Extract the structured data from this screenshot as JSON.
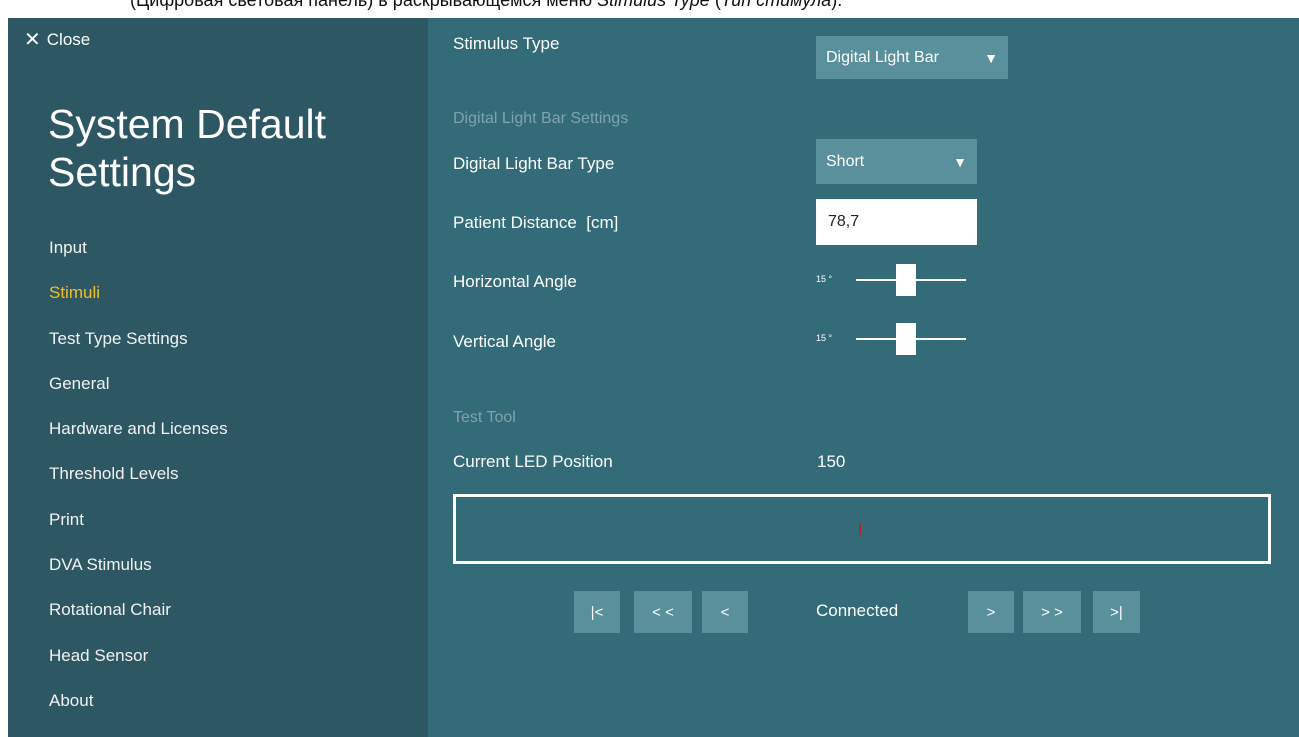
{
  "caption": {
    "prefix": "(Цифровая световая панель) в раскрывающемся меню ",
    "menu": "Stimulus Type",
    "middle": " (",
    "translation": "Тип стимула",
    "suffix": ")."
  },
  "sidebar": {
    "close_label": "Close",
    "title": "System Default Settings",
    "items": [
      {
        "label": "Input"
      },
      {
        "label": "Stimuli",
        "active": true
      },
      {
        "label": "Test Type Settings"
      },
      {
        "label": "General"
      },
      {
        "label": "Hardware and Licenses"
      },
      {
        "label": "Threshold Levels"
      },
      {
        "label": "Print"
      },
      {
        "label": "DVA Stimulus"
      },
      {
        "label": "Rotational Chair"
      },
      {
        "label": "Head Sensor"
      },
      {
        "label": "About"
      }
    ]
  },
  "main": {
    "stimulus_type": {
      "label": "Stimulus Type",
      "value": "Digital Light Bar"
    },
    "dlb_section_title": "Digital Light Bar Settings",
    "dlb_type": {
      "label": "Digital Light Bar Type",
      "value": "Short"
    },
    "patient_distance": {
      "label": "Patient Distance",
      "unit": "[cm]",
      "value": "78,7"
    },
    "horizontal_angle": {
      "label": "Horizontal Angle",
      "value": "15 °"
    },
    "vertical_angle": {
      "label": "Vertical Angle",
      "value": "15 °"
    },
    "test_tool_title": "Test Tool",
    "current_led": {
      "label": "Current LED Position",
      "value": "150"
    },
    "status": "Connected",
    "buttons": {
      "first": "|<",
      "prev_fast": "< <",
      "prev": "<",
      "next": ">",
      "next_fast": "> >",
      "last": ">|"
    }
  },
  "colors": {
    "sidebar_bg": "#2c5763",
    "content_bg": "#336b79",
    "control_bg": "#5a8f9c",
    "active_nav": "#f0c11e",
    "led_marker": "#b3262b"
  }
}
